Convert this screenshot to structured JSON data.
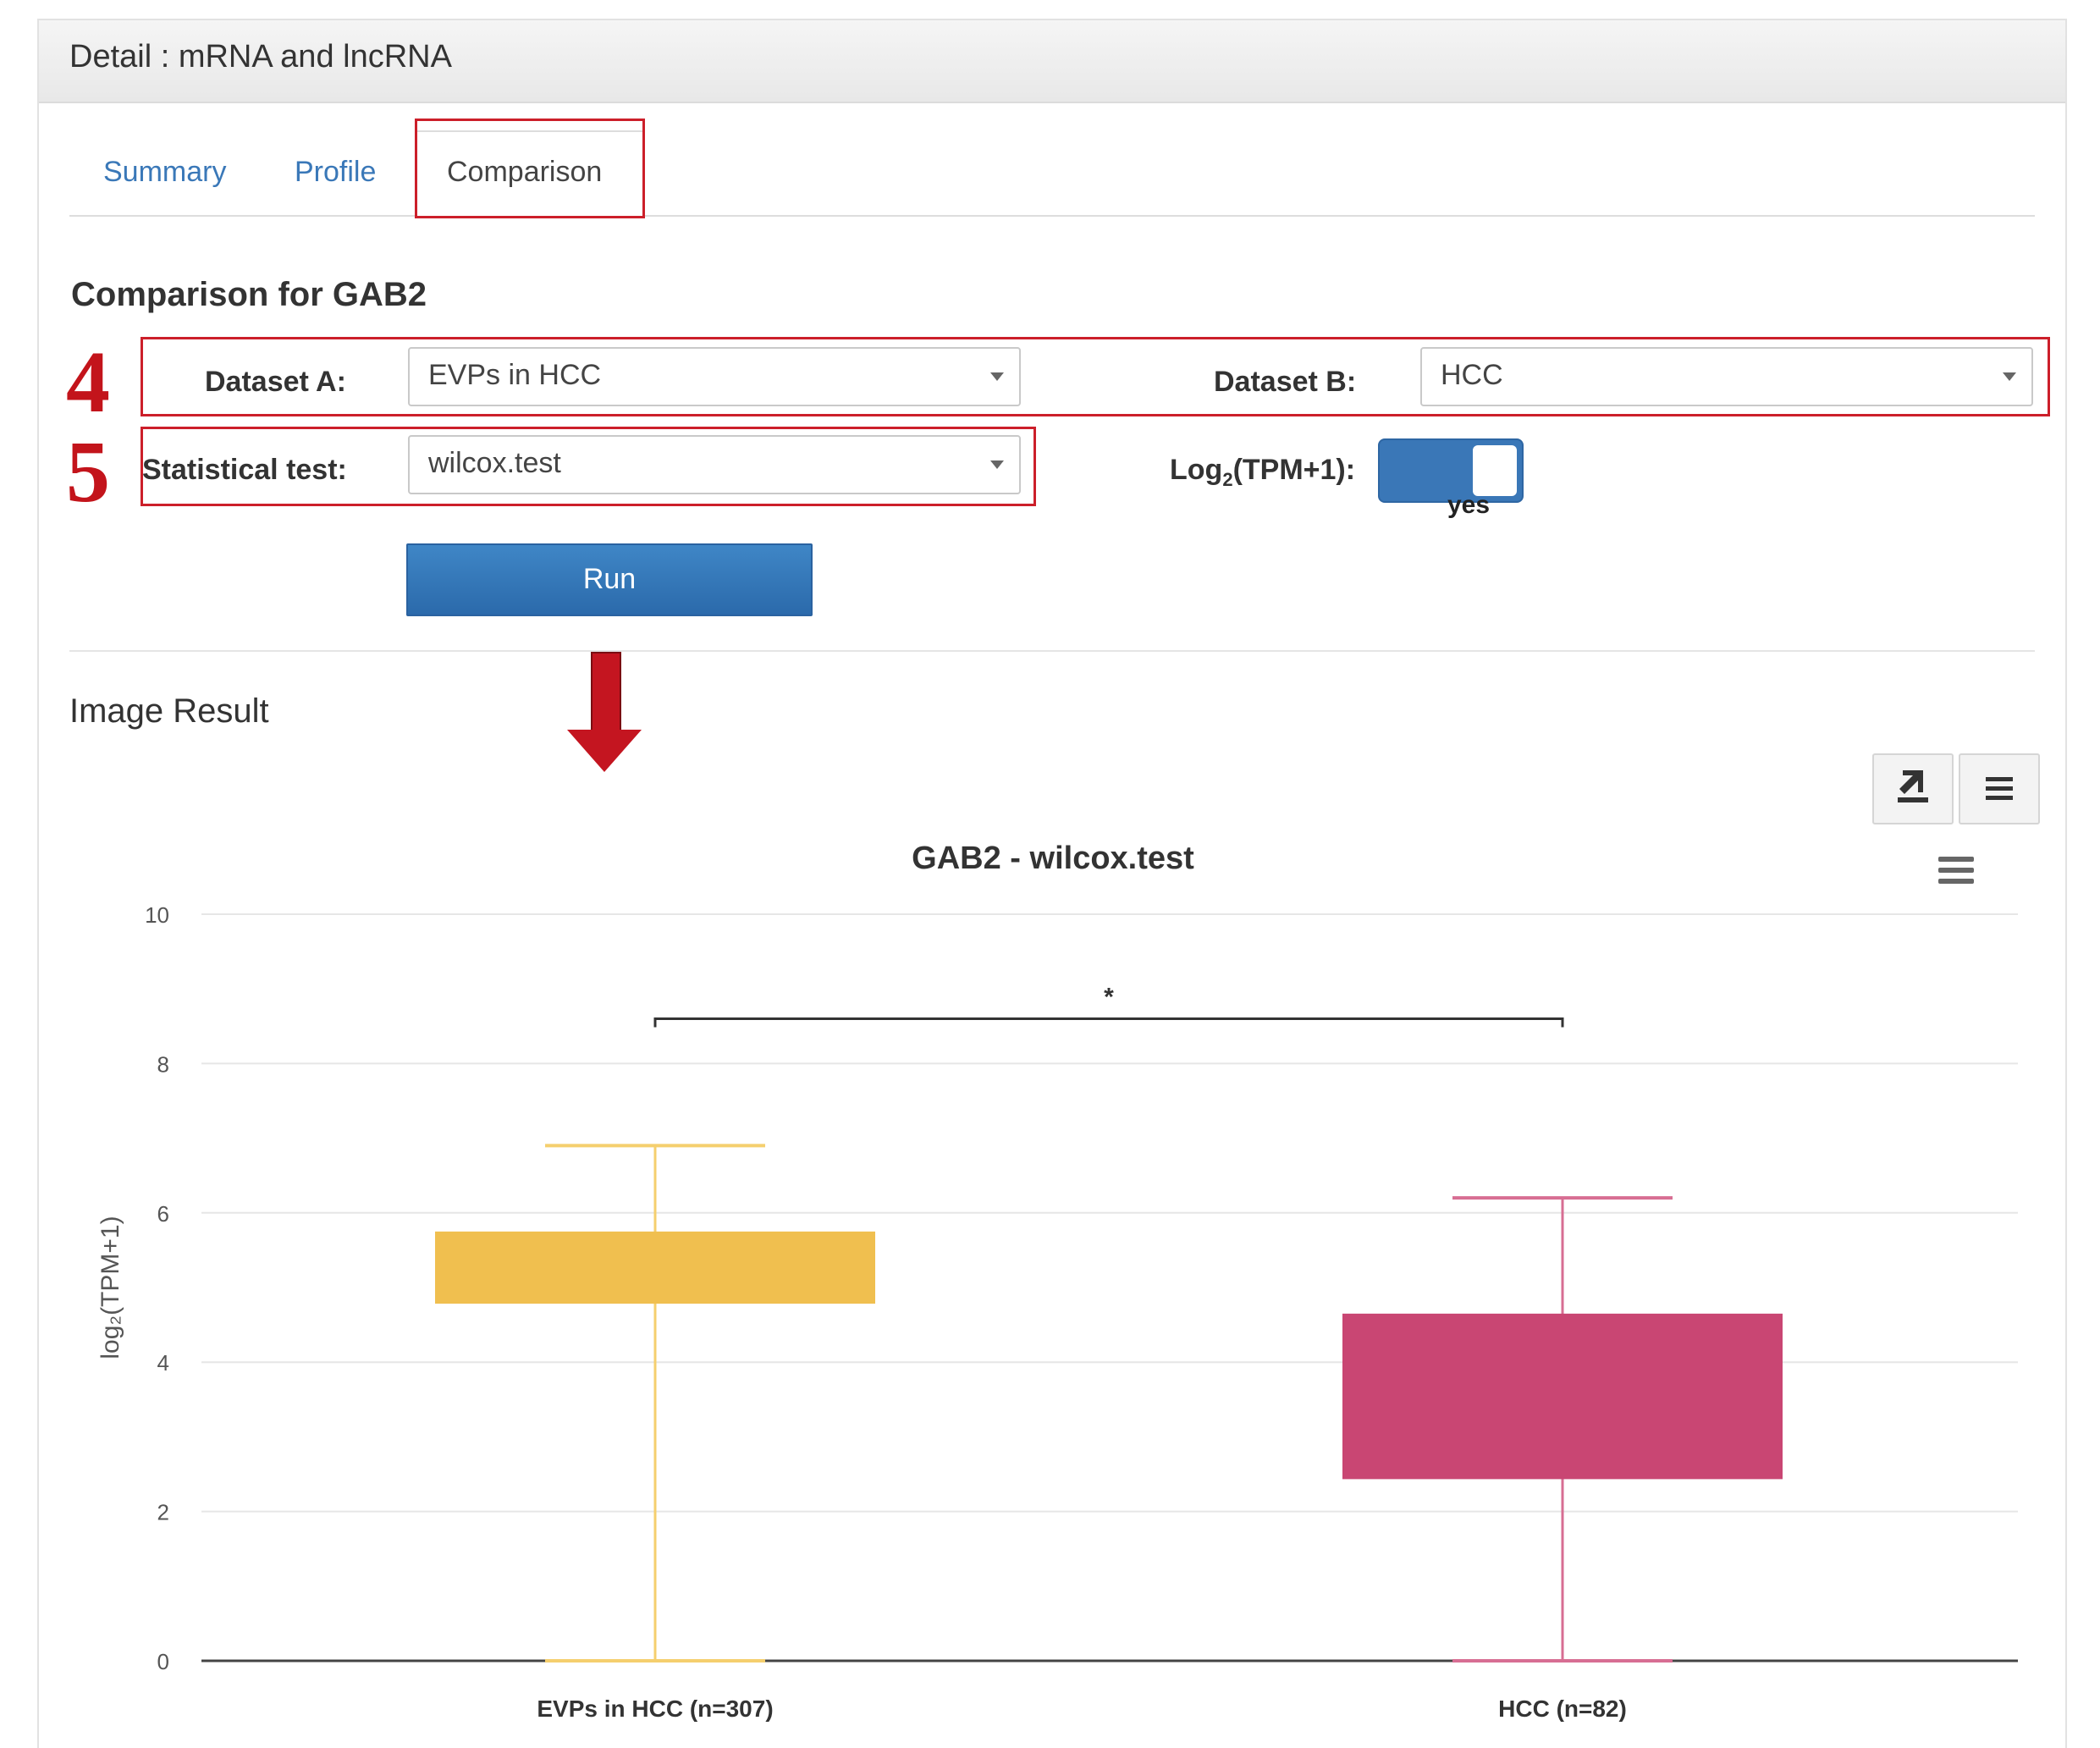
{
  "panel": {
    "title": "Detail : mRNA and lncRNA"
  },
  "tabs": [
    {
      "label": "Summary",
      "active": false
    },
    {
      "label": "Profile",
      "active": false
    },
    {
      "label": "Comparison",
      "active": true
    }
  ],
  "section_title": "Comparison for GAB2",
  "steps": {
    "dataset_step": "4",
    "test_step": "5"
  },
  "form": {
    "dataset_a_label": "Dataset A:",
    "dataset_a_value": "EVPs in HCC",
    "dataset_b_label": "Dataset B:",
    "dataset_b_value": "HCC",
    "stat_test_label": "Statistical test:",
    "stat_test_value": "wilcox.test",
    "log_label_pre": "Log",
    "log_label_sub": "2",
    "log_label_post": "(TPM+1):",
    "log_toggle_state": "yes",
    "run_label": "Run"
  },
  "result": {
    "title": "Image Result"
  },
  "icons": {
    "download": "download-icon",
    "menu": "hamburger-menu-icon",
    "chart_menu": "chart-context-menu-icon",
    "arrow": "down-arrow-icon"
  },
  "colors": {
    "accent_blue": "#3a77b7",
    "annotation_red": "#cc1f2a",
    "series_a": "#f0bf4f",
    "series_b": "#c94673"
  },
  "chart_data": {
    "type": "box",
    "title": "GAB2 - wilcox.test",
    "xlabel": "",
    "ylabel": "log₂(TPM+1)",
    "ylim": [
      0,
      10
    ],
    "yticks": [
      0,
      2,
      4,
      6,
      8,
      10
    ],
    "grid": true,
    "categories": [
      "EVPs in HCC (n=307)",
      "HCC (n=82)"
    ],
    "series": [
      {
        "min": 0.0,
        "q1": 4.8,
        "median": 4.8,
        "q3": 5.75,
        "max": 6.9,
        "color": "#f0bf4f",
        "whisker_color": "#f5cf6e"
      },
      {
        "min": 0.0,
        "q1": 2.45,
        "median": 2.45,
        "q3": 4.65,
        "max": 6.2,
        "color": "#c94673",
        "whisker_color": "#d76e93"
      }
    ],
    "significance": {
      "label": "*",
      "y": 8.6
    }
  }
}
